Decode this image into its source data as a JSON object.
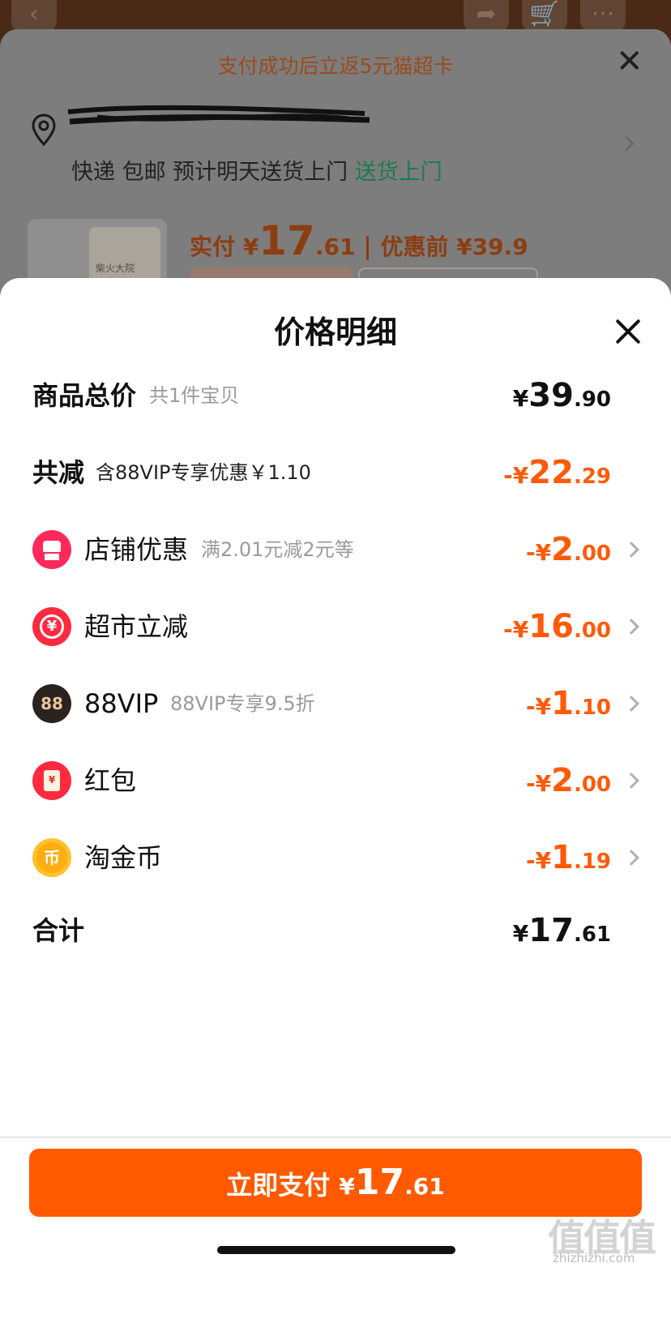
{
  "background": {
    "promo_text": "支付成功后立返5元猫超卡",
    "address_redacted": "",
    "delivery_text": "快递 包邮 预计明天送货上门 ",
    "delivery_highlight": "送货上门",
    "product_brand": "柴火大院",
    "actual_pay_label": "实付 ¥",
    "actual_pay_int": "17",
    "actual_pay_dec": ".61",
    "pre_discount_label": "优惠前 ¥39.9"
  },
  "sheet": {
    "title": "价格明细",
    "subtotal": {
      "label": "商品总价",
      "note": "共1件宝贝",
      "sym": "¥",
      "int": "39",
      "dec": ".90"
    },
    "reduction": {
      "label": "共减",
      "note": "含88VIP专享优惠￥1.10",
      "sym": "-¥",
      "int": "22",
      "dec": ".29"
    },
    "items": [
      {
        "label": "店铺优惠",
        "note": "满2.01元减2元等",
        "sym": "-¥",
        "int": "2",
        "dec": ".00",
        "icon": "store-icon"
      },
      {
        "label": "超市立减",
        "note": "",
        "sym": "-¥",
        "int": "16",
        "dec": ".00",
        "icon": "supermarket-yen-icon"
      },
      {
        "label": "88VIP",
        "note": "88VIP专享9.5折",
        "sym": "-¥",
        "int": "1",
        "dec": ".10",
        "icon": "vip88-icon"
      },
      {
        "label": "红包",
        "note": "",
        "sym": "-¥",
        "int": "2",
        "dec": ".00",
        "icon": "red-packet-icon"
      },
      {
        "label": "淘金币",
        "note": "",
        "sym": "-¥",
        "int": "1",
        "dec": ".19",
        "icon": "gold-coin-icon"
      }
    ],
    "vip_icon_text": "88",
    "market_icon_text": "¥",
    "redpacket_icon_text": "¥",
    "coin_icon_text": "币",
    "total": {
      "label": "合计",
      "sym": "¥",
      "int": "17",
      "dec": ".61"
    },
    "pay_button": {
      "label": "立即支付 ",
      "sym": "¥",
      "int": "17",
      "dec": ".61"
    }
  },
  "watermark": {
    "main": "值值值",
    "sub": "zhizhizhi.com"
  },
  "colors": {
    "accent": "#ff5a00",
    "discount": "#ff5a0a",
    "delivery_green": "#1c7a56"
  }
}
